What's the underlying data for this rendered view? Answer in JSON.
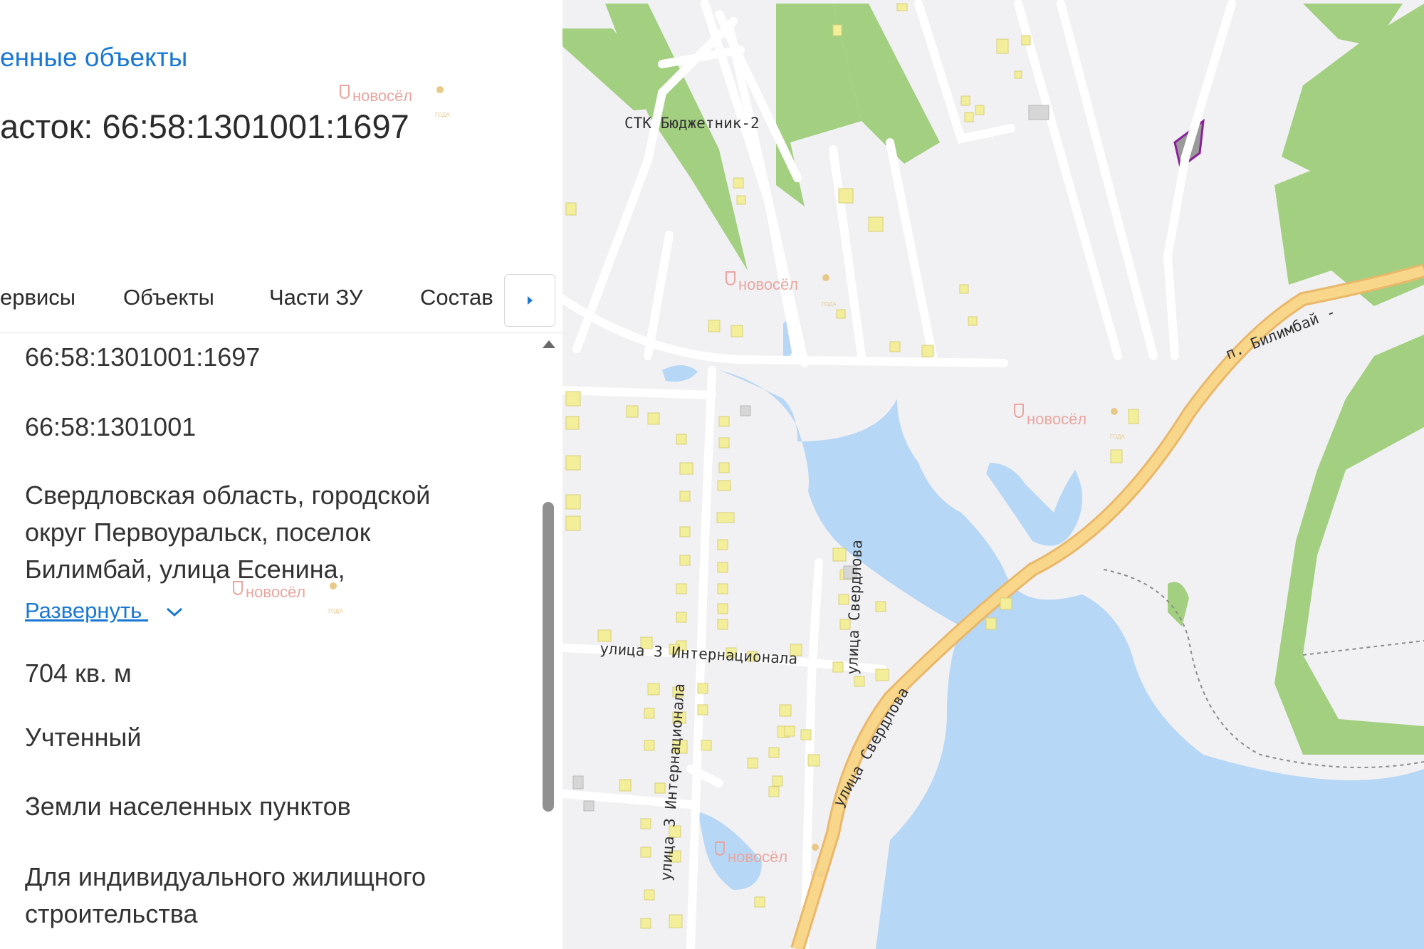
{
  "header": {
    "breadcrumb": "енные объекты",
    "title": "асток: 66:58:1301001:1697"
  },
  "tabs": [
    {
      "label": "ервисы"
    },
    {
      "label": "Объекты"
    },
    {
      "label": "Части ЗУ"
    },
    {
      "label": "Состав"
    }
  ],
  "properties": {
    "cadastral_number": "66:58:1301001:1697",
    "cadastral_quarter": "66:58:1301001",
    "address": "Свердловская область, городской округ Первоуральск, поселок Билимбай, улица Есенина,",
    "expand_label": "Развернуть",
    "area": "704 кв. м",
    "status": "Учтенный",
    "category": "Земли населенных пунктов",
    "permitted_use": "Для индивидуального жилищного строительства"
  },
  "watermark": {
    "brand": "новосёл",
    "small_text": "ГОДА"
  },
  "map": {
    "labels": {
      "stk": "СТК  Бюджетник-2",
      "bilimbay": "п. Билимбай -",
      "internationala_h": "улица 3 Интернационала",
      "internationala_v": "улица 3 Интернационала",
      "sverdlova_v": "улица Свердлова",
      "sverdlova_diag": "улица Свердлова"
    },
    "colors": {
      "forest": "#a3cf80",
      "water": "#b6d7f5",
      "road_major": "#f8d68a",
      "building": "#f3ee9a",
      "land": "#f1f1f4",
      "parcel": "#8a1f9c"
    }
  },
  "icons": {
    "tab_next": "chevron-right-icon",
    "expand": "chevron-down-icon",
    "scroll_up": "caret-up-icon"
  }
}
